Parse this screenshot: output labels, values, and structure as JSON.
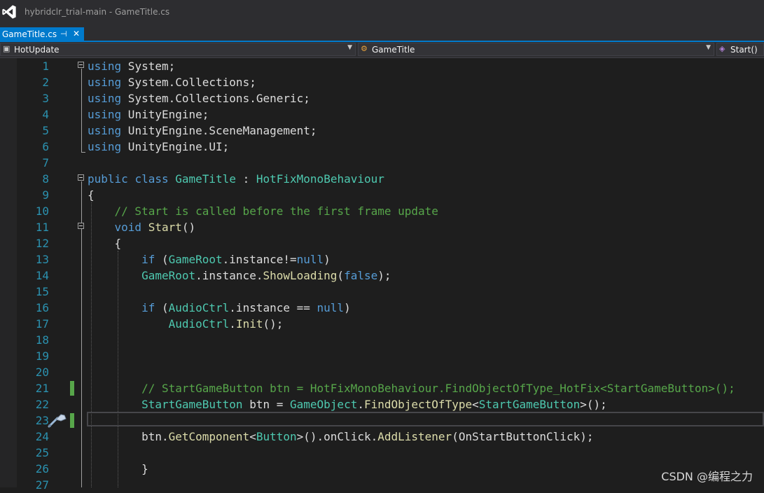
{
  "titlebar": {
    "title": "hybridclr_trial-main - GameTitle.cs"
  },
  "tab": {
    "label": "GameTitle.cs",
    "pin": "⊣",
    "close": "✕"
  },
  "navbar": {
    "project": "HotUpdate",
    "class": "GameTitle",
    "member": "Start()"
  },
  "editor": {
    "line_numbers": [
      "1",
      "2",
      "3",
      "4",
      "5",
      "6",
      "7",
      "8",
      "9",
      "10",
      "11",
      "12",
      "13",
      "14",
      "15",
      "16",
      "17",
      "18",
      "19",
      "20",
      "21",
      "22",
      "23",
      "24",
      "25",
      "26",
      "27"
    ],
    "lines": [
      {
        "tokens": [
          {
            "t": "using",
            "c": "kw"
          },
          {
            "t": " System;",
            "c": ""
          }
        ]
      },
      {
        "tokens": [
          {
            "t": "using",
            "c": "kw"
          },
          {
            "t": " System.Collections;",
            "c": ""
          }
        ]
      },
      {
        "tokens": [
          {
            "t": "using",
            "c": "kw"
          },
          {
            "t": " System.Collections.Generic;",
            "c": ""
          }
        ]
      },
      {
        "tokens": [
          {
            "t": "using",
            "c": "kw"
          },
          {
            "t": " UnityEngine;",
            "c": ""
          }
        ]
      },
      {
        "tokens": [
          {
            "t": "using",
            "c": "kw"
          },
          {
            "t": " UnityEngine.SceneManagement;",
            "c": ""
          }
        ]
      },
      {
        "tokens": [
          {
            "t": "using",
            "c": "kw"
          },
          {
            "t": " UnityEngine.UI;",
            "c": ""
          }
        ]
      },
      {
        "tokens": []
      },
      {
        "tokens": [
          {
            "t": "public",
            "c": "kw"
          },
          {
            "t": " ",
            "c": ""
          },
          {
            "t": "class",
            "c": "kw"
          },
          {
            "t": " ",
            "c": ""
          },
          {
            "t": "GameTitle",
            "c": "ty"
          },
          {
            "t": " : ",
            "c": ""
          },
          {
            "t": "HotFixMonoBehaviour",
            "c": "ty"
          }
        ]
      },
      {
        "tokens": [
          {
            "t": "{",
            "c": ""
          }
        ]
      },
      {
        "tokens": [
          {
            "t": "    // Start is called before the first frame update",
            "c": "cm"
          }
        ]
      },
      {
        "tokens": [
          {
            "t": "    ",
            "c": ""
          },
          {
            "t": "void",
            "c": "kw"
          },
          {
            "t": " ",
            "c": ""
          },
          {
            "t": "Start",
            "c": "fn"
          },
          {
            "t": "()",
            "c": ""
          }
        ]
      },
      {
        "tokens": [
          {
            "t": "    {",
            "c": ""
          }
        ]
      },
      {
        "tokens": [
          {
            "t": "        ",
            "c": ""
          },
          {
            "t": "if",
            "c": "kw"
          },
          {
            "t": " (",
            "c": ""
          },
          {
            "t": "GameRoot",
            "c": "ty"
          },
          {
            "t": ".instance!=",
            "c": ""
          },
          {
            "t": "null",
            "c": "kw"
          },
          {
            "t": ")",
            "c": ""
          }
        ]
      },
      {
        "tokens": [
          {
            "t": "        ",
            "c": ""
          },
          {
            "t": "GameRoot",
            "c": "ty"
          },
          {
            "t": ".instance.",
            "c": ""
          },
          {
            "t": "ShowLoading",
            "c": "fn"
          },
          {
            "t": "(",
            "c": ""
          },
          {
            "t": "false",
            "c": "kw"
          },
          {
            "t": ");",
            "c": ""
          }
        ]
      },
      {
        "tokens": []
      },
      {
        "tokens": [
          {
            "t": "        ",
            "c": ""
          },
          {
            "t": "if",
            "c": "kw"
          },
          {
            "t": " (",
            "c": ""
          },
          {
            "t": "AudioCtrl",
            "c": "ty"
          },
          {
            "t": ".instance == ",
            "c": ""
          },
          {
            "t": "null",
            "c": "kw"
          },
          {
            "t": ")",
            "c": ""
          }
        ]
      },
      {
        "tokens": [
          {
            "t": "            ",
            "c": ""
          },
          {
            "t": "AudioCtrl",
            "c": "ty"
          },
          {
            "t": ".",
            "c": ""
          },
          {
            "t": "Init",
            "c": "fn"
          },
          {
            "t": "();",
            "c": ""
          }
        ]
      },
      {
        "tokens": []
      },
      {
        "tokens": []
      },
      {
        "tokens": []
      },
      {
        "tokens": [
          {
            "t": "        // StartGameButton btn = HotFixMonoBehaviour.FindObjectOfType_HotFix<StartGameButton>();",
            "c": "cm"
          }
        ]
      },
      {
        "tokens": [
          {
            "t": "        ",
            "c": ""
          },
          {
            "t": "StartGameButton",
            "c": "ty"
          },
          {
            "t": " btn = ",
            "c": ""
          },
          {
            "t": "GameObject",
            "c": "ty"
          },
          {
            "t": ".",
            "c": ""
          },
          {
            "t": "FindObjectOfType",
            "c": "fn"
          },
          {
            "t": "<",
            "c": ""
          },
          {
            "t": "StartGameButton",
            "c": "ty"
          },
          {
            "t": ">();",
            "c": ""
          }
        ]
      },
      {
        "tokens": []
      },
      {
        "tokens": [
          {
            "t": "        btn.",
            "c": ""
          },
          {
            "t": "GetComponent",
            "c": "fn"
          },
          {
            "t": "<",
            "c": ""
          },
          {
            "t": "Button",
            "c": "ty"
          },
          {
            "t": ">().onClick.",
            "c": ""
          },
          {
            "t": "AddListener",
            "c": "fn"
          },
          {
            "t": "(OnStartButtonClick);",
            "c": ""
          }
        ]
      },
      {
        "tokens": []
      },
      {
        "tokens": [
          {
            "t": "        }",
            "c": ""
          }
        ]
      },
      {
        "tokens": []
      }
    ]
  },
  "watermark": "CSDN @编程之力",
  "colors": {
    "accent": "#007acc",
    "keyword": "#569cd6",
    "type": "#4ec9b0",
    "method": "#dcdcaa",
    "comment": "#57a64a",
    "line_number": "#2b91af",
    "change_bar": "#57a64a"
  }
}
